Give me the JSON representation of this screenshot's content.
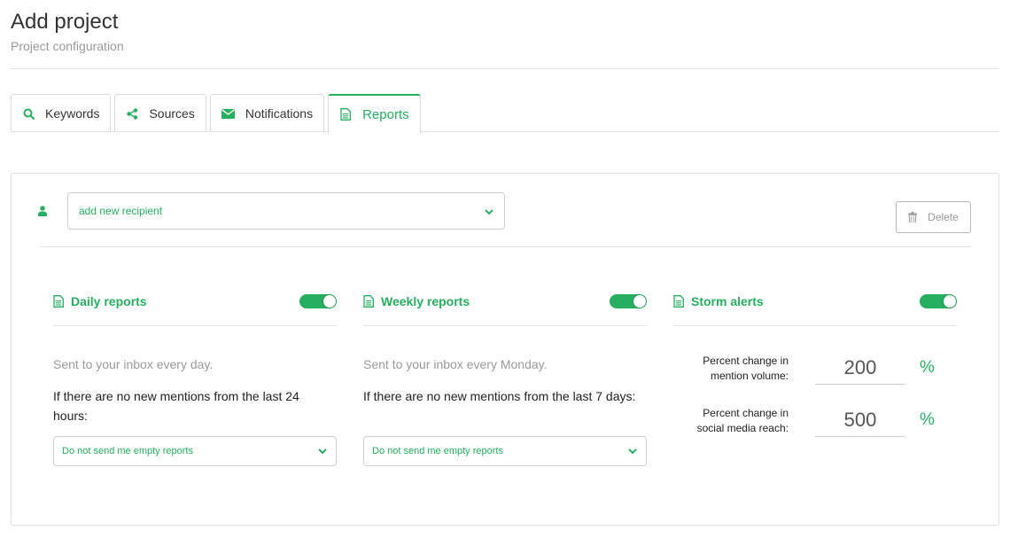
{
  "page": {
    "title": "Add project",
    "subtitle": "Project configuration"
  },
  "tabs": [
    {
      "label": "Keywords",
      "icon": "search-icon"
    },
    {
      "label": "Sources",
      "icon": "share-icon"
    },
    {
      "label": "Notifications",
      "icon": "envelope-icon"
    },
    {
      "label": "Reports",
      "icon": "document-icon",
      "active": true
    }
  ],
  "recipient": {
    "icon": "user-icon",
    "placeholder": "add new recipient",
    "delete_label": "Delete"
  },
  "reports": {
    "daily": {
      "title": "Daily reports",
      "enabled": true,
      "description": "Sent to your inbox every day.",
      "question": "If there are no new mentions from the last 24 hours:",
      "selected_option": "Do not send me empty reports"
    },
    "weekly": {
      "title": "Weekly reports",
      "enabled": true,
      "description": "Sent to your inbox every Monday.",
      "question": "If there are no new mentions from the last 7 days:",
      "selected_option": "Do not send me empty reports"
    },
    "storm": {
      "title": "Storm alerts",
      "enabled": true,
      "rows": [
        {
          "label": "Percent change in mention volume:",
          "value": "200",
          "unit": "%"
        },
        {
          "label": "Percent change in social media reach:",
          "value": "500",
          "unit": "%"
        }
      ]
    }
  },
  "colors": {
    "accent": "#27ae60",
    "muted_text": "#9a9a9a",
    "border": "#dcdcdc"
  }
}
